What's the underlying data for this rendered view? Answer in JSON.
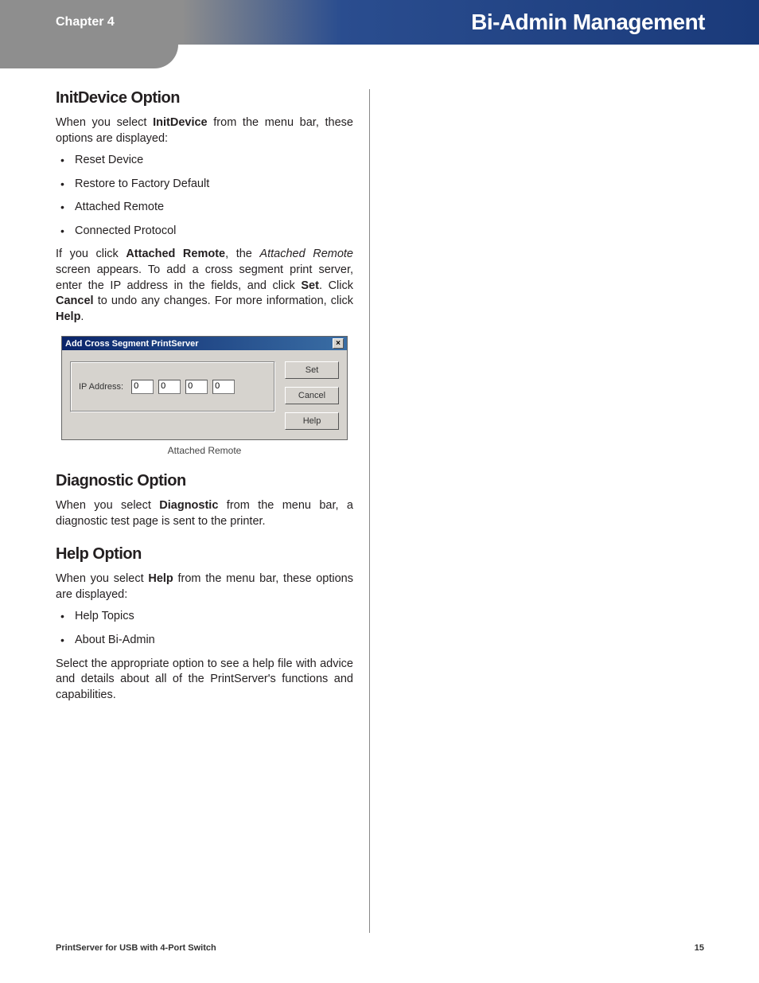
{
  "header": {
    "chapter": "Chapter 4",
    "title": "Bi-Admin Management"
  },
  "sections": {
    "initdevice": {
      "heading": "InitDevice Option",
      "intro_pre": "When you select ",
      "intro_bold": "InitDevice",
      "intro_post": " from the menu bar, these options are displayed:",
      "items": [
        "Reset Device",
        "Restore to Factory Default",
        "Attached Remote",
        "Connected Protocol"
      ],
      "p2_a": "If you click ",
      "p2_b": "Attached Remote",
      "p2_c": ", the ",
      "p2_d": "Attached Remote",
      "p2_e": " screen appears. To add a cross segment print server, enter the IP address in the fields, and click ",
      "p2_f": "Set",
      "p2_g": ". Click ",
      "p2_h": "Cancel",
      "p2_i": " to undo any changes. For more information, click ",
      "p2_j": "Help",
      "p2_k": "."
    },
    "dialog": {
      "title": "Add Cross Segment PrintServer",
      "close": "×",
      "ip_label": "IP Address:",
      "ip_values": [
        "0",
        "0",
        "0",
        "0"
      ],
      "buttons": {
        "set": "Set",
        "cancel": "Cancel",
        "help": "Help"
      },
      "caption": "Attached Remote"
    },
    "diagnostic": {
      "heading": "Diagnostic Option",
      "text_a": "When you select ",
      "text_b": "Diagnostic",
      "text_c": " from the menu bar, a diagnostic test page is sent to the printer."
    },
    "help": {
      "heading": "Help Option",
      "intro_a": "When you select ",
      "intro_b": "Help",
      "intro_c": " from the menu bar, these options are displayed:",
      "items": [
        "Help Topics",
        "About Bi-Admin"
      ],
      "outro": "Select the appropriate option to see a help file with advice and details about all of the PrintServer's functions and capabilities."
    }
  },
  "footer": {
    "product": "PrintServer for USB with 4-Port Switch",
    "page": "15"
  }
}
